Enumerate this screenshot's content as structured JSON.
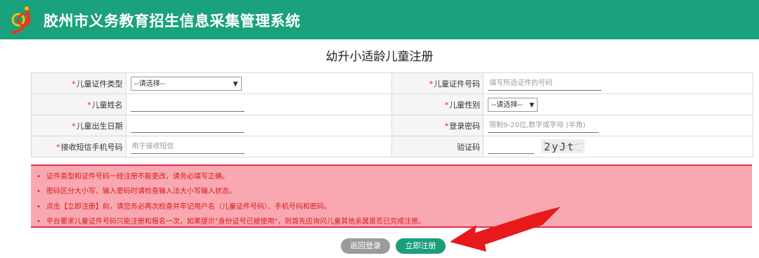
{
  "header": {
    "title": "胶州市义务教育招生信息采集管理系统",
    "brand_color": "#1aa17d"
  },
  "page": {
    "title": "幼升小适龄儿童注册"
  },
  "form": {
    "required_mark": "*",
    "id_type_label": "儿童证件类型",
    "id_type_value": "--请选择--",
    "id_number_label": "儿童证件号码",
    "id_number_placeholder": "填写所选证件的号码",
    "name_label": "儿童姓名",
    "gender_label": "儿童性别",
    "gender_value": "--请选择--",
    "birth_label": "儿童出生日期",
    "password_label": "登录密码",
    "password_placeholder": "限制9-20位,数字或字母 (半角)",
    "phone_label": "接收短信手机号码",
    "phone_placeholder": "用于接收短信",
    "captcha_label": "验证码",
    "captcha_text": "2yJt"
  },
  "notices": [
    "证件类型和证件号码一经注册不能更改，请务必填写正确。",
    "密码区分大小写，输入密码时请检查输入法大小写输入状态。",
    "点击【立即注册】前，请您务必再次检查并牢记用户名（儿童证件号码）、手机号码和密码。",
    "平台要求儿童证件号码只能注册和报名一次，如果提示\"身份证号已被使用\"，则首先应询问儿童其他亲属是否已完成注册。"
  ],
  "notice_bullet": "•",
  "buttons": {
    "back_label": "返回登录",
    "register_label": "立即注册"
  },
  "icons": {
    "dropdown": "chevron-down-icon",
    "logo": "logo-icon",
    "annotation": "red-arrow-icon"
  },
  "colors": {
    "notice_bg": "#f9a8b2",
    "notice_text": "#d81b1b",
    "arrow": "#e8191b"
  }
}
